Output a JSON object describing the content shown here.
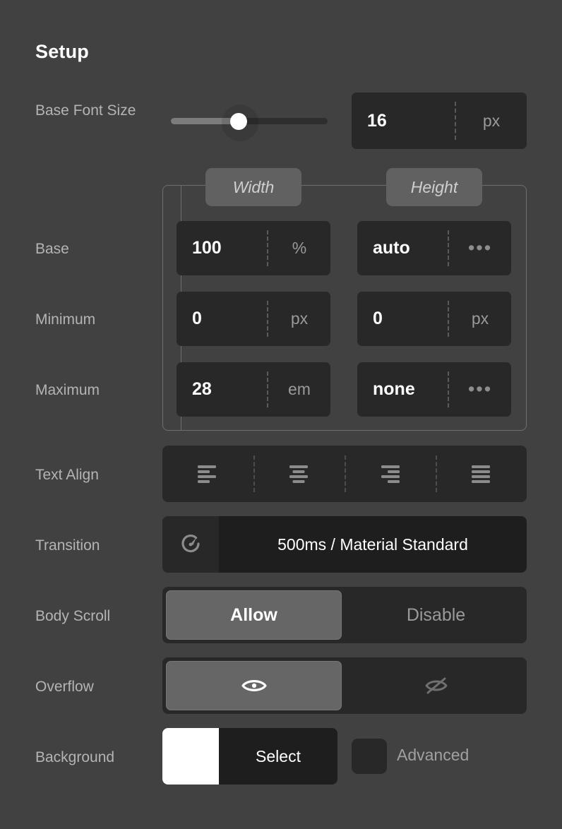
{
  "panel": {
    "title": "Setup",
    "background_color": "#414141",
    "field_color": "#282828",
    "accent_color": "#666666"
  },
  "rows": {
    "base_font_size": {
      "label": "Base Font Size",
      "slider": {
        "value": 16,
        "fill_percent": 42
      },
      "field": {
        "value": "16",
        "unit": "px"
      }
    },
    "sizing": {
      "legend_width": "Width",
      "legend_height": "Height",
      "base": {
        "label": "Base",
        "width": {
          "value": "100",
          "unit": "%"
        },
        "height": {
          "value": "auto",
          "unit": "•••"
        }
      },
      "minimum": {
        "label": "Minimum",
        "width": {
          "value": "0",
          "unit": "px"
        },
        "height": {
          "value": "0",
          "unit": "px"
        }
      },
      "maximum": {
        "label": "Maximum",
        "width": {
          "value": "28",
          "unit": "em"
        },
        "height": {
          "value": "none",
          "unit": "•••"
        }
      }
    },
    "text_align": {
      "label": "Text Align",
      "options": [
        {
          "name": "align-left",
          "selected": false
        },
        {
          "name": "align-center",
          "selected": false
        },
        {
          "name": "align-right",
          "selected": false
        },
        {
          "name": "align-justify",
          "selected": false
        }
      ]
    },
    "transition": {
      "label": "Transition",
      "icon": "speedometer-icon",
      "value": "500ms / Material Standard"
    },
    "body_scroll": {
      "label": "Body Scroll",
      "options": [
        {
          "label": "Allow",
          "selected": true
        },
        {
          "label": "Disable",
          "selected": false
        }
      ]
    },
    "overflow": {
      "label": "Overflow",
      "options": [
        {
          "icon": "eye-icon",
          "selected": true
        },
        {
          "icon": "eye-off-icon",
          "selected": false
        }
      ]
    },
    "background": {
      "label": "Background",
      "swatch_color": "#ffffff",
      "select_label": "Select",
      "advanced_label": "Advanced",
      "advanced_checked": false
    }
  }
}
